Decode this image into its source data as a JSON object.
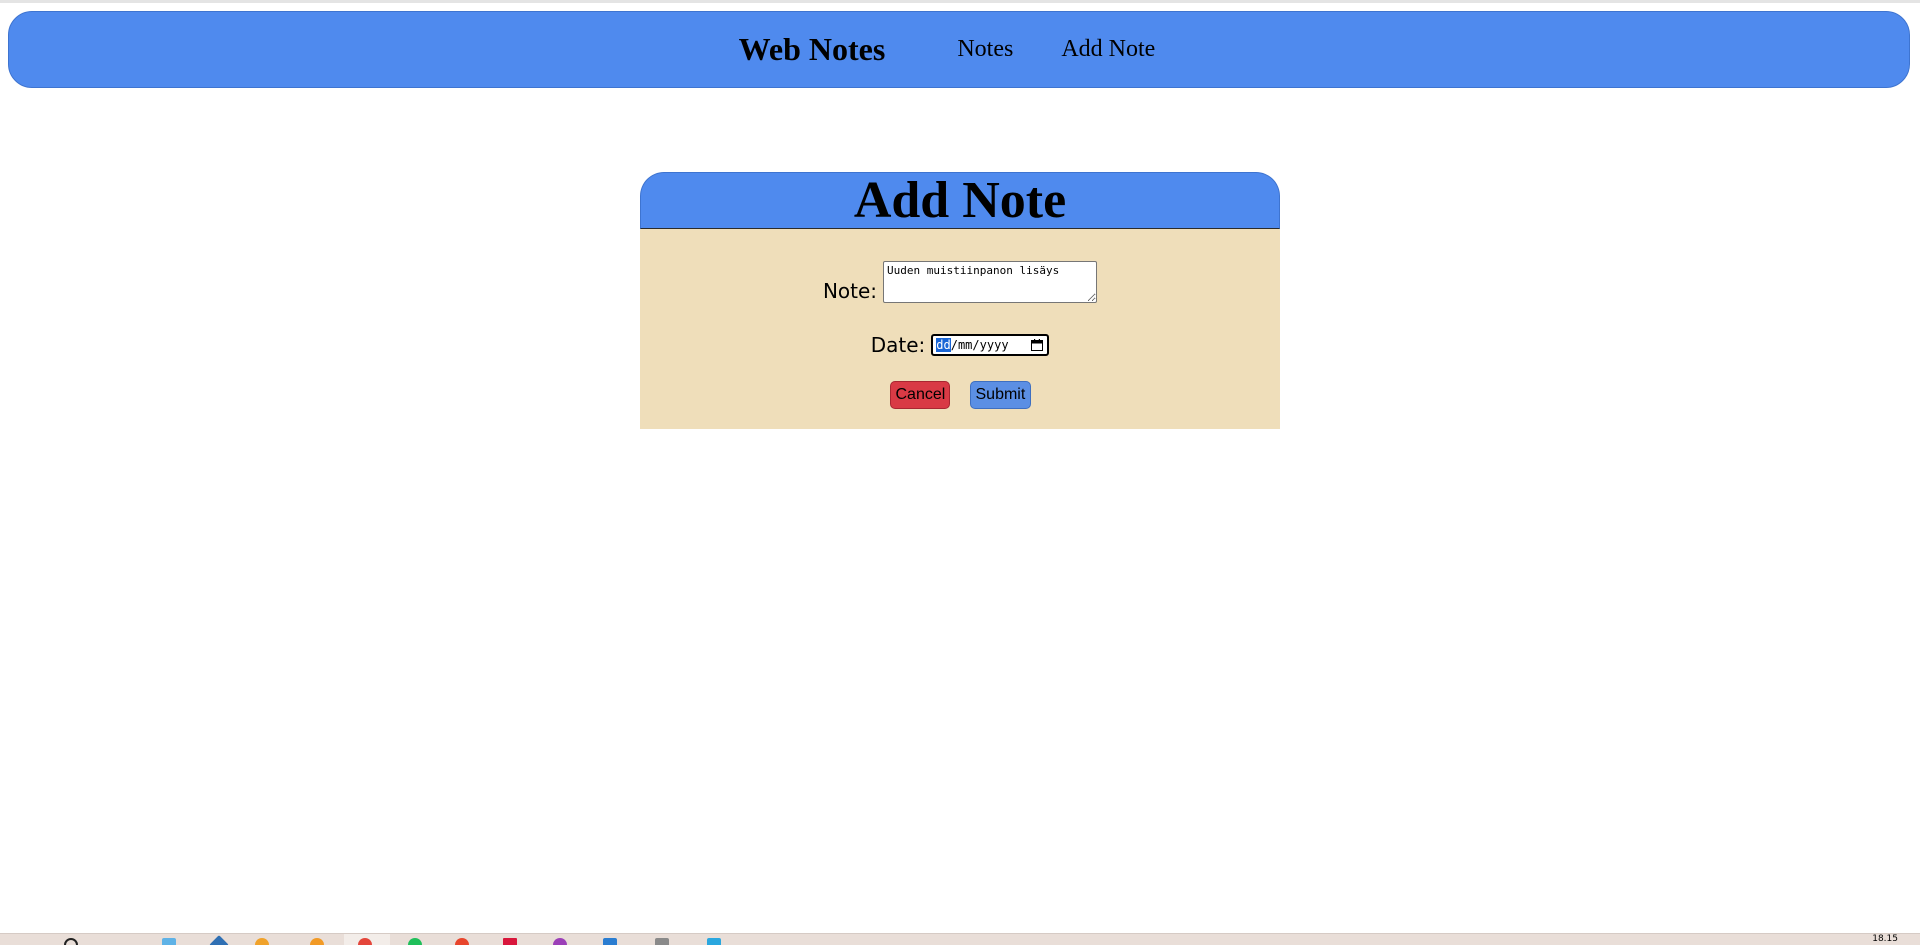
{
  "navbar": {
    "brand": "Web Notes",
    "links": [
      "Notes",
      "Add Note"
    ],
    "color": "#4f8aee"
  },
  "form": {
    "title": "Add Note",
    "note_label": "Note:",
    "note_value": "Uuden muistiinpanon lisäys",
    "date_label": "Date:",
    "date_placeholder": {
      "day": "dd",
      "month": "mm",
      "year": "yyyy",
      "separator": "/"
    },
    "cancel_label": "Cancel",
    "submit_label": "Submit",
    "body_color": "#efdeba",
    "cancel_color": "#d93a45",
    "submit_color": "#5b8fe4"
  },
  "taskbar": {
    "clock": "18.15",
    "icons": [
      "search-icon",
      "file-explorer-icon",
      "store-icon",
      "firefox-icon",
      "chrome-icon",
      "spotify-icon",
      "brave-icon",
      "app-red-icon",
      "app-purple-icon",
      "vscode-icon",
      "app-grey-icon",
      "app-blue-icon"
    ]
  }
}
